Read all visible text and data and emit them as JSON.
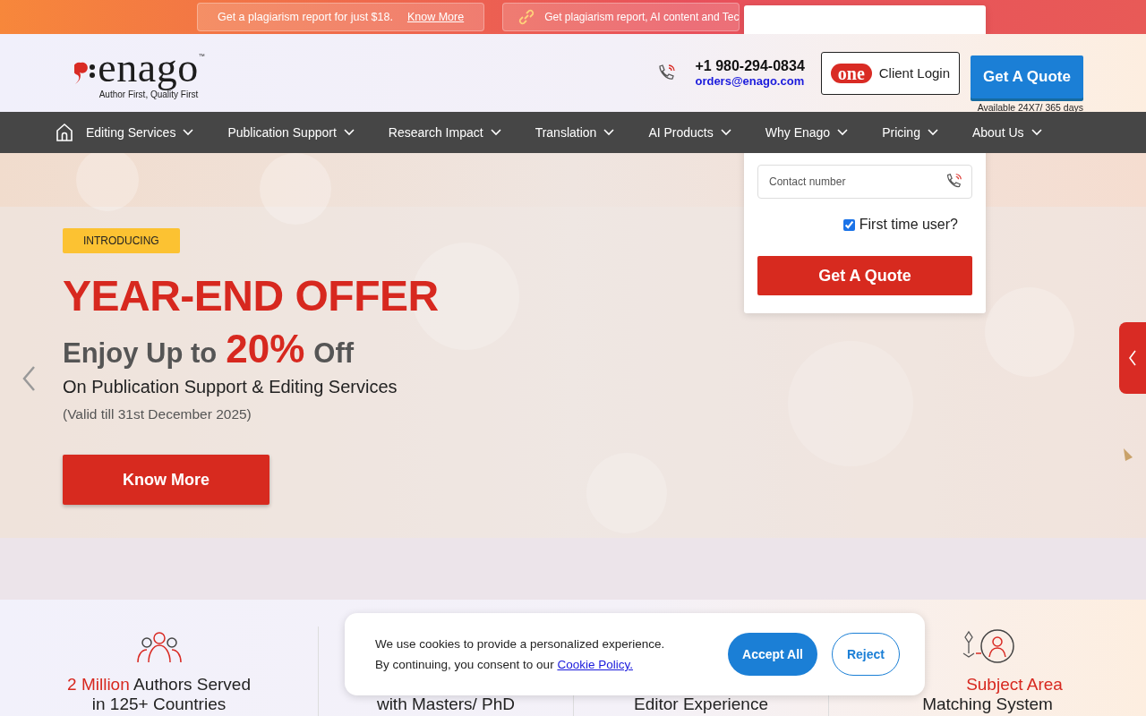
{
  "promo_bar": {
    "items": [
      {
        "kind": "plain",
        "text": "Get a plagiarism report for just $18.",
        "link": "Know More"
      },
      {
        "kind": "icon",
        "text": "Get plagiarism report, AI content and Tec"
      }
    ]
  },
  "header": {
    "logo": {
      "wordmark": "enago",
      "trademark": "™",
      "tagline": "Author First, Quality First"
    },
    "phone": "+1 980-294-0834",
    "email": "orders@enago.com",
    "client_login": {
      "badge": "one",
      "label": "Client Login"
    },
    "quote_button": "Get A Quote",
    "availability": "Available 24X7/ 365 days"
  },
  "nav": {
    "items": [
      {
        "label": "Editing Services"
      },
      {
        "label": "Publication Support"
      },
      {
        "label": "Research Impact"
      },
      {
        "label": "Translation"
      },
      {
        "label": "AI Products"
      },
      {
        "label": "Why Enago"
      },
      {
        "label": "Pricing"
      },
      {
        "label": "About Us"
      }
    ]
  },
  "quote_form": {
    "contact_field": {
      "placeholder": "Contact number"
    },
    "first_time_user": {
      "label": "First time user?",
      "checked": true
    },
    "submit": "Get A Quote"
  },
  "hero": {
    "badge": "INTRODUCING",
    "headline": "YEAR-END OFFER",
    "offer": {
      "before": "Enjoy Up to",
      "highlight": "20%",
      "after": "Off"
    },
    "subline": "On Publication Support & Editing Services",
    "validity": "(Valid till 31st December 2025)",
    "cta": "Know More"
  },
  "stats": [
    {
      "kind": "people",
      "highlight": "2 Million",
      "rest": "Authors Served",
      "line2": "in 125+ Countries"
    },
    {
      "kind": "hidden",
      "line2": "with Masters/ PhD"
    },
    {
      "kind": "hidden",
      "line2": "Editor Experience"
    },
    {
      "kind": "match",
      "highlight": "Subject Area",
      "line2": "Matching System"
    }
  ],
  "cookie_banner": {
    "line1": "We use cookies to provide a personalized experience.",
    "line2": "By continuing, you consent to our",
    "policy_link": "Cookie Policy.",
    "accept": "Accept All",
    "reject": "Reject"
  }
}
